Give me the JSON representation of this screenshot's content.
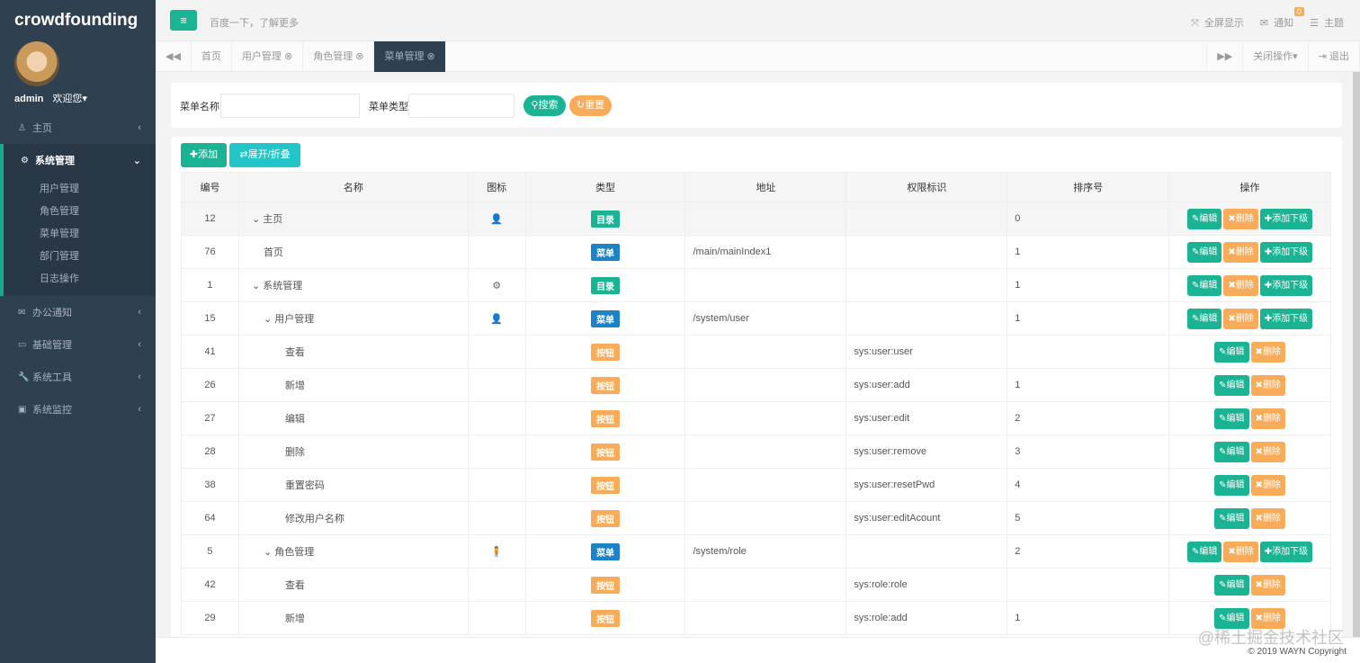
{
  "sidebar": {
    "brand": "crowdfounding",
    "user": "admin",
    "welcome": "欢迎您▾",
    "items": [
      {
        "label": "主页",
        "icon": "user-icon"
      },
      {
        "label": "系统管理",
        "icon": "gears-icon"
      },
      {
        "label": "办公通知",
        "icon": "envelope-icon"
      },
      {
        "label": "基础管理",
        "icon": "id-card-icon"
      },
      {
        "label": "系统工具",
        "icon": "wrench-icon"
      },
      {
        "label": "系统监控",
        "icon": "monitor-icon"
      }
    ],
    "sub": [
      "用户管理",
      "角色管理",
      "菜单管理",
      "部门管理",
      "日志操作"
    ]
  },
  "header": {
    "search_hint": "百度一下，了解更多",
    "fullscreen": "全屏显示",
    "notify": "通知",
    "notify_count": "0",
    "theme": "主题"
  },
  "tabs": [
    {
      "label": "首页"
    },
    {
      "label": "用户管理 ⊗"
    },
    {
      "label": "角色管理 ⊗"
    },
    {
      "label": "菜单管理 ⊗"
    }
  ],
  "tabs_right": {
    "close_ops": "关闭操作▾",
    "logout": "退出"
  },
  "search": {
    "name_label": "菜单名称",
    "name_value": "",
    "type_label": "菜单类型",
    "type_value": "",
    "search": "搜索",
    "reset": "重置"
  },
  "toolbar": {
    "add": "添加",
    "toggle": "展开/折叠"
  },
  "table": {
    "headers": [
      "编号",
      "名称",
      "图标",
      "类型",
      "地址",
      "权限标识",
      "排序号",
      "操作"
    ],
    "rows": [
      {
        "id": "12",
        "name": "主页",
        "level": 0,
        "exp": true,
        "icon": "👤",
        "type": "目录",
        "url": "",
        "perm": "",
        "order": "0",
        "child": true
      },
      {
        "id": "76",
        "name": "首页",
        "level": 1,
        "exp": false,
        "icon": "",
        "type": "菜单",
        "url": "/main/mainIndex1",
        "perm": "",
        "order": "1",
        "child": true
      },
      {
        "id": "1",
        "name": "系统管理",
        "level": 0,
        "exp": true,
        "icon": "⚙",
        "type": "目录",
        "url": "",
        "perm": "",
        "order": "1",
        "child": true
      },
      {
        "id": "15",
        "name": "用户管理",
        "level": 1,
        "exp": true,
        "icon": "👤",
        "type": "菜单",
        "url": "/system/user",
        "perm": "",
        "order": "1",
        "child": true
      },
      {
        "id": "41",
        "name": "查看",
        "level": 2,
        "exp": false,
        "icon": "",
        "type": "按钮",
        "url": "",
        "perm": "sys:user:user",
        "order": "",
        "child": false
      },
      {
        "id": "26",
        "name": "新增",
        "level": 2,
        "exp": false,
        "icon": "",
        "type": "按钮",
        "url": "",
        "perm": "sys:user:add",
        "order": "1",
        "child": false
      },
      {
        "id": "27",
        "name": "编辑",
        "level": 2,
        "exp": false,
        "icon": "",
        "type": "按钮",
        "url": "",
        "perm": "sys:user:edit",
        "order": "2",
        "child": false
      },
      {
        "id": "28",
        "name": "删除",
        "level": 2,
        "exp": false,
        "icon": "",
        "type": "按钮",
        "url": "",
        "perm": "sys:user:remove",
        "order": "3",
        "child": false
      },
      {
        "id": "38",
        "name": "重置密码",
        "level": 2,
        "exp": false,
        "icon": "",
        "type": "按钮",
        "url": "",
        "perm": "sys:user:resetPwd",
        "order": "4",
        "child": false
      },
      {
        "id": "64",
        "name": "修改用户名称",
        "level": 2,
        "exp": false,
        "icon": "",
        "type": "按钮",
        "url": "",
        "perm": "sys:user:editAcount",
        "order": "5",
        "child": false
      },
      {
        "id": "5",
        "name": "角色管理",
        "level": 1,
        "exp": true,
        "icon": "🧍",
        "type": "菜单",
        "url": "/system/role",
        "perm": "",
        "order": "2",
        "child": true
      },
      {
        "id": "42",
        "name": "查看",
        "level": 2,
        "exp": false,
        "icon": "",
        "type": "按钮",
        "url": "",
        "perm": "sys:role:role",
        "order": "",
        "child": false
      },
      {
        "id": "29",
        "name": "新增",
        "level": 2,
        "exp": false,
        "icon": "",
        "type": "按钮",
        "url": "",
        "perm": "sys:role:add",
        "order": "1",
        "child": false
      }
    ]
  },
  "actions": {
    "edit": "编辑",
    "delete": "删除",
    "add_child": "添加下级"
  },
  "type_colors": {
    "目录": "#1ab394",
    "菜单": "#1c84c6",
    "按钮": "#f8ac59"
  },
  "footer": {
    "copyright": "© 2019 WAYN Copyright",
    "watermark": "@稀土掘金技术社区"
  }
}
